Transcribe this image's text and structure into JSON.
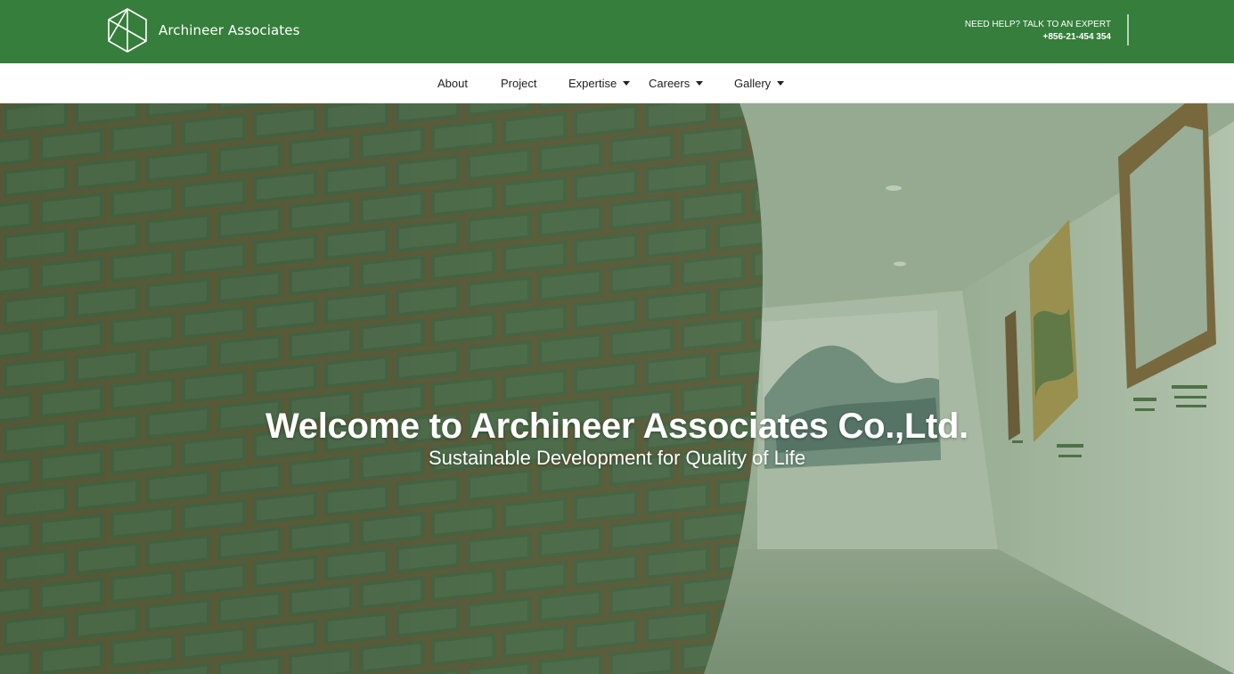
{
  "header": {
    "brand_name": "Archineer Associates",
    "logo_icon": "cube-outline-icon",
    "help_label": "NEED HELP? TALK TO AN EXPERT",
    "help_phone": "+856-21-454 354"
  },
  "nav": {
    "items": [
      {
        "label": "About",
        "has_dropdown": false
      },
      {
        "label": "Project",
        "has_dropdown": false
      },
      {
        "label": "Expertise",
        "has_dropdown": true
      },
      {
        "label": "Careers",
        "has_dropdown": true
      },
      {
        "label": "Gallery",
        "has_dropdown": true
      }
    ]
  },
  "hero": {
    "title": "Welcome to Archineer Associates Co.,Ltd.",
    "subtitle": "Sustainable Development for Quality of Life"
  },
  "colors": {
    "header_green": "#367e3b",
    "nav_background": "#ffffff",
    "hero_tint": "#4d6a4b",
    "text_light": "#ffffff",
    "text_dark": "#1f1f1f"
  }
}
